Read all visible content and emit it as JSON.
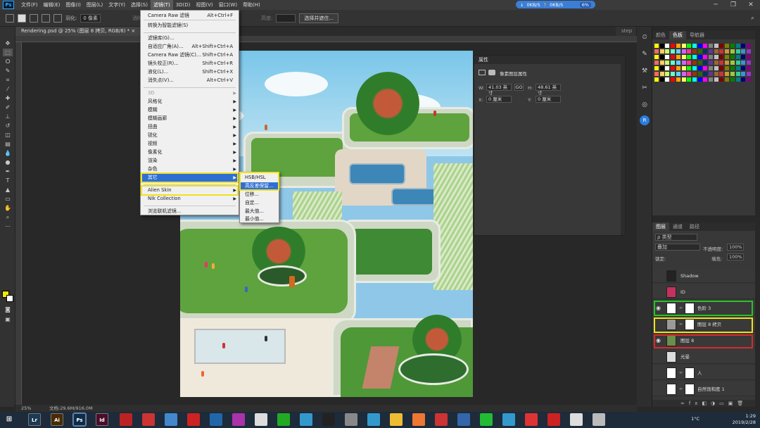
{
  "app": {
    "logo": "Ps",
    "menus": [
      "文件(F)",
      "编辑(E)",
      "图像(I)",
      "图层(L)",
      "文字(Y)",
      "选择(S)",
      "滤镜(T)",
      "3D(D)",
      "视图(V)",
      "窗口(W)",
      "帮助(H)"
    ],
    "active_menu_index": 6,
    "net": {
      "down": "0KB/S",
      "up": "0KB/S",
      "pct": "6%"
    }
  },
  "options_bar": {
    "feather_label": "羽化:",
    "feather_value": "0 像素",
    "antialias_label": "消除锯齿",
    "height_label": "高度:",
    "select_mask_button": "选择并遮住..."
  },
  "tabs": [
    {
      "label": "Rendering.psd @ 25% (图层 8 拷贝, RGB/8) *  ×"
    },
    {
      "label": "step"
    }
  ],
  "filter_menu": {
    "items": [
      {
        "label": "Camera Raw 滤镜",
        "shortcut": "Alt+Ctrl+F"
      },
      {
        "label": "转换为智能滤镜(S)",
        "shortcut": ""
      },
      {
        "label": "滤镜库(G)...",
        "shortcut": ""
      },
      {
        "label": "自适应广角(A)...",
        "shortcut": "Alt+Shift+Ctrl+A"
      },
      {
        "label": "Camera Raw 滤镜(C)...",
        "shortcut": "Shift+Ctrl+A"
      },
      {
        "label": "镜头校正(R)...",
        "shortcut": "Shift+Ctrl+R"
      },
      {
        "label": "液化(L)...",
        "shortcut": "Shift+Ctrl+X"
      },
      {
        "label": "消失点(V)...",
        "shortcut": "Alt+Ctrl+V"
      },
      {
        "label": "3D",
        "shortcut": ""
      },
      {
        "label": "风格化",
        "shortcut": ""
      },
      {
        "label": "模糊",
        "shortcut": ""
      },
      {
        "label": "模糊画廊",
        "shortcut": ""
      },
      {
        "label": "扭曲",
        "shortcut": ""
      },
      {
        "label": "锐化",
        "shortcut": ""
      },
      {
        "label": "视频",
        "shortcut": ""
      },
      {
        "label": "像素化",
        "shortcut": ""
      },
      {
        "label": "渲染",
        "shortcut": ""
      },
      {
        "label": "杂色",
        "shortcut": ""
      },
      {
        "label": "其它",
        "shortcut": ""
      },
      {
        "label": "Alien Skin",
        "shortcut": ""
      },
      {
        "label": "Nik Collection",
        "shortcut": ""
      },
      {
        "label": "浏览联机滤镜...",
        "shortcut": ""
      }
    ]
  },
  "submenu": {
    "items": [
      "HSB/HSL",
      "高反差保留...",
      "位移...",
      "自定...",
      "最大值...",
      "最小值..."
    ]
  },
  "properties": {
    "title": "属性",
    "subtitle": "像素图层属性",
    "w_label": "W:",
    "w_value": "41.03 英寸",
    "link_label": "GO",
    "h_label": "H:",
    "h_value": "48.61 英寸",
    "x_label": "X:",
    "x_value": "0 厘米",
    "y_label": "Y:",
    "y_value": "0 厘米"
  },
  "swatches": {
    "tabs": [
      "颜色",
      "色板",
      "导航器"
    ],
    "colors": [
      "#ffff00",
      "#000000",
      "#ffffff",
      "#ff0000",
      "#ffa500",
      "#ffff66",
      "#00ff00",
      "#00ffff",
      "#0000ff",
      "#ff00ff",
      "#808080",
      "#c0c0c0",
      "#800000",
      "#808000",
      "#008000",
      "#008080",
      "#000080",
      "#800080",
      "#ff6666",
      "#ffcc66",
      "#ccff66",
      "#66ffcc",
      "#66ccff",
      "#cc66ff",
      "#ff3399",
      "#993300",
      "#336600",
      "#003366",
      "#663399",
      "#996633",
      "#cc3333",
      "#cc9933",
      "#99cc33",
      "#33cc99",
      "#3399cc",
      "#9933cc"
    ]
  },
  "layers": {
    "tabs": [
      "图层",
      "通道",
      "路径"
    ],
    "filter_label": "ρ 类型",
    "blend_mode": "叠加",
    "opacity_label": "不透明度:",
    "opacity_value": "100%",
    "lock_label": "锁定:",
    "fill_label": "填充:",
    "fill_value": "100%",
    "items": [
      {
        "name": "Shadow",
        "visible": false,
        "mask": false
      },
      {
        "name": "ID",
        "visible": false,
        "mask": false
      },
      {
        "name": "色阶 3",
        "visible": true,
        "mask": true
      },
      {
        "name": "图层 8 拷贝",
        "visible": false,
        "mask": true
      },
      {
        "name": "图层 8",
        "visible": true,
        "mask": false
      },
      {
        "name": "光晕",
        "visible": false,
        "mask": false
      },
      {
        "name": "人",
        "visible": false,
        "mask": true
      },
      {
        "name": "自然饱和度 1",
        "visible": false,
        "mask": true
      }
    ]
  },
  "status": {
    "zoom": "25%",
    "doc": "文档:29.6M/916.0M"
  },
  "taskbar": {
    "apps": [
      {
        "label": "Lr",
        "color": "#1c3a52"
      },
      {
        "label": "Ai",
        "color": "#4a2a05"
      },
      {
        "label": "Ps",
        "color": "#0e2c4a"
      },
      {
        "label": "Id",
        "color": "#4a0d2a"
      }
    ],
    "tray": {
      "time": "1:29",
      "date": "2019/2/28",
      "weather": "1°C"
    }
  },
  "colors": {
    "menu_highlight": "#2f6fd4",
    "yellow_box": "#f0e21c",
    "green_box": "#29c229",
    "red_box": "#d62b2b",
    "fg_swatch": "#f5e800"
  }
}
